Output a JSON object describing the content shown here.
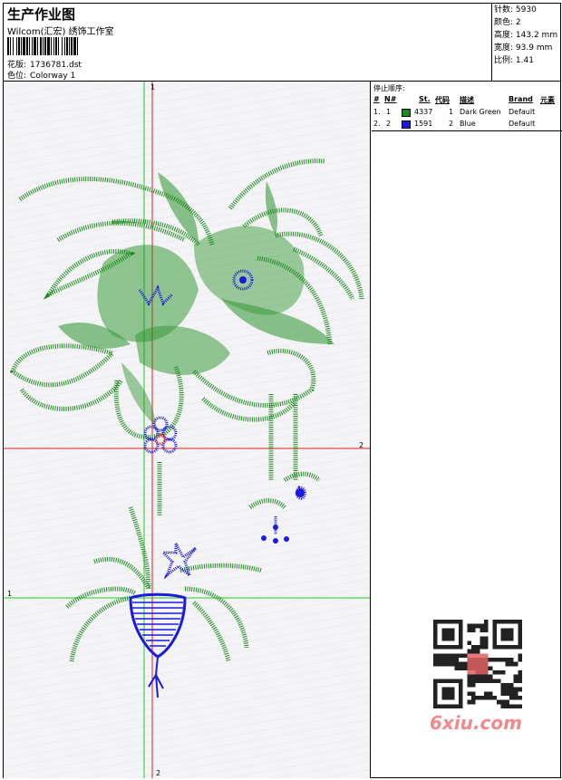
{
  "header": {
    "title": "生产作业图",
    "subtitle": "Wilcom(汇宏) 绣饰工作室",
    "design_label": "花版:",
    "design_value": "1736781.dst",
    "color_label": "色位:",
    "color_value": "Colorway 1"
  },
  "stats": [
    {
      "label": "针数:",
      "value": "5930"
    },
    {
      "label": "颜色:",
      "value": "2"
    },
    {
      "label": "高度:",
      "value": "143.2 mm"
    },
    {
      "label": "宽度:",
      "value": "93.9 mm"
    },
    {
      "label": "比例:",
      "value": "1.41"
    }
  ],
  "stop_sequence": {
    "title": "停止顺序:",
    "columns": [
      "#",
      "N#",
      "St.",
      "代码",
      "描述",
      "Brand",
      "元素"
    ],
    "rows": [
      {
        "num": "1.",
        "n": "1",
        "stitches": "4337",
        "code": "1",
        "desc": "Dark Green",
        "brand": "Default",
        "color": "#1c8c1c"
      },
      {
        "num": "2.",
        "n": "2",
        "stitches": "1591",
        "code": "2",
        "desc": "Blue",
        "brand": "Default",
        "color": "#1a1ae0"
      }
    ]
  },
  "guides": {
    "v_green_top": "1",
    "v_red_bottom": "2",
    "h_red_right": "2",
    "h_green_left": "1"
  },
  "watermark": {
    "text": "6xiu.com"
  }
}
